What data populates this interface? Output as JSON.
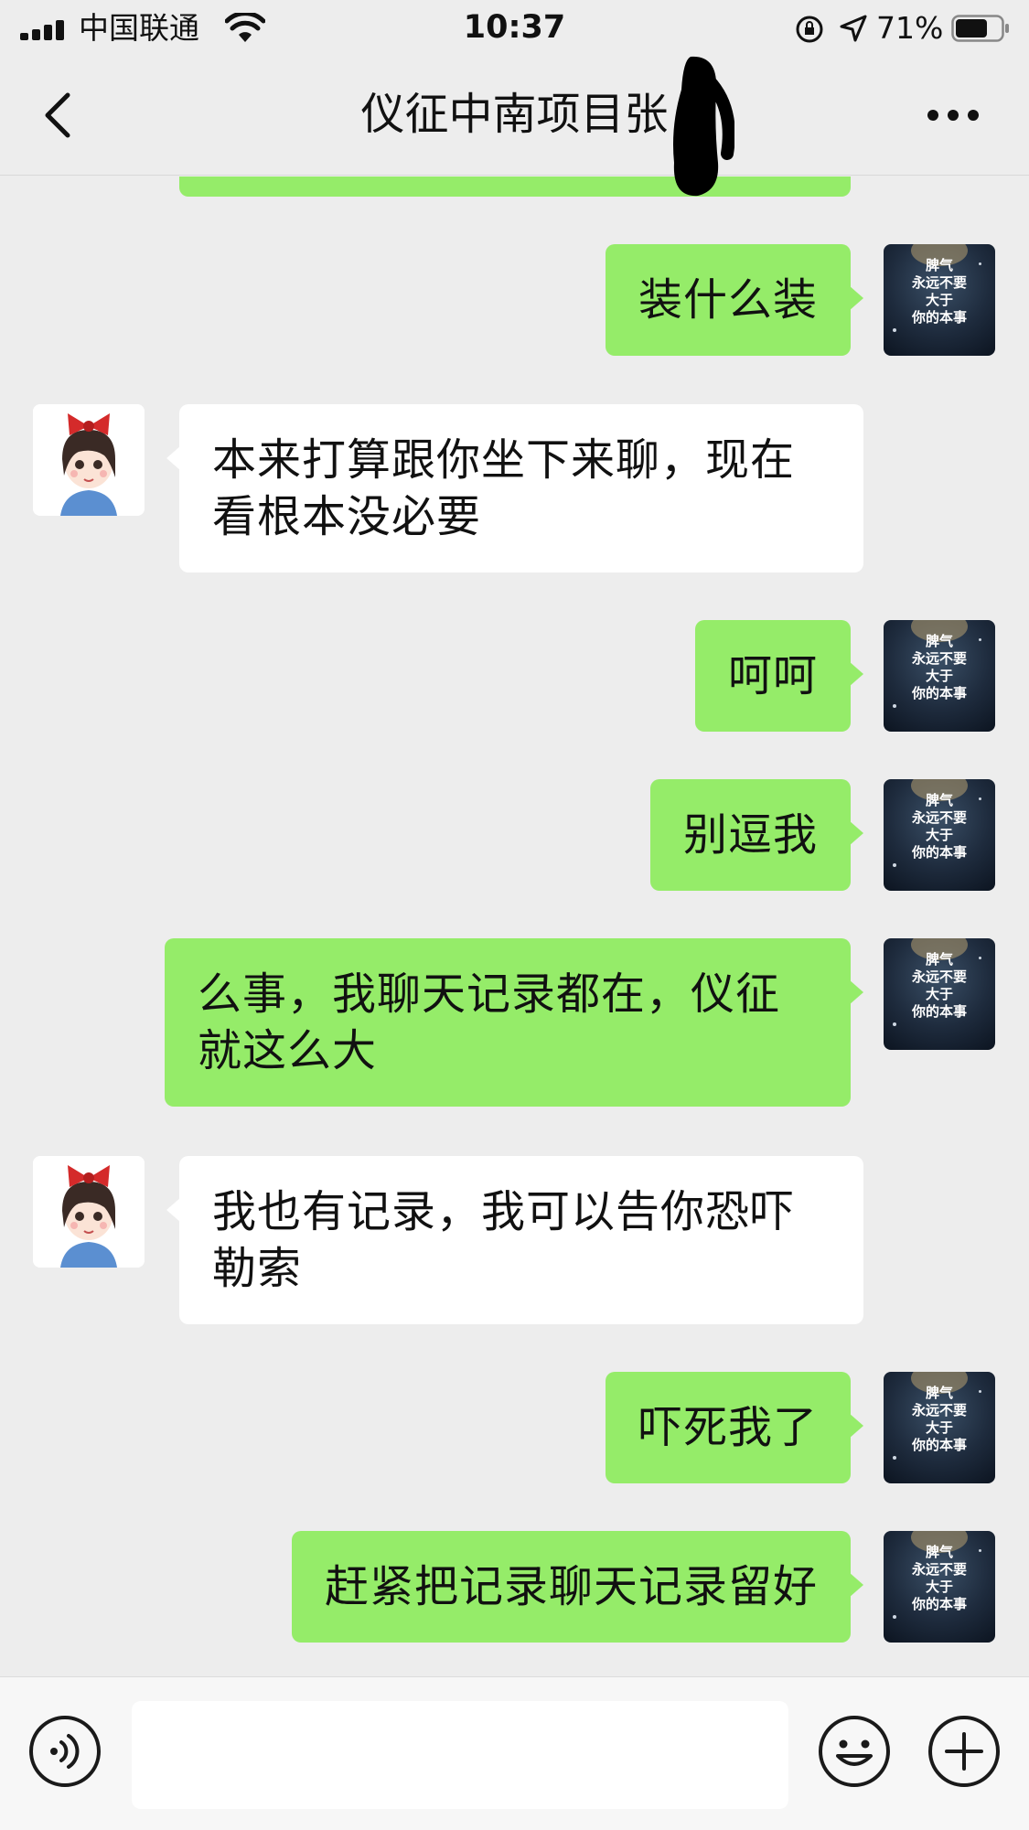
{
  "status_bar": {
    "carrier": "中国联通",
    "time": "10:37",
    "battery_percent": "71%",
    "battery_level": 0.71,
    "icons": [
      "signal-icon",
      "wifi-icon",
      "rotation-lock-icon",
      "location-arrow-icon",
      "battery-icon"
    ]
  },
  "nav": {
    "title": "仪征中南项目张",
    "back_icon": "chevron-left-icon",
    "more_icon": "ellipsis-icon"
  },
  "self_avatar_text": [
    "脾气",
    "永远不要",
    "大于",
    "你的本事"
  ],
  "messages": [
    {
      "sender": "self",
      "text": "装什么装"
    },
    {
      "sender": "other",
      "text": "本来打算跟你坐下来聊，现在看根本没必要"
    },
    {
      "sender": "self",
      "text": "呵呵"
    },
    {
      "sender": "self",
      "text": "别逗我"
    },
    {
      "sender": "self",
      "text": "么事，我聊天记录都在，仪征就这么大"
    },
    {
      "sender": "other",
      "text": "我也有记录，我可以告你恐吓勒索"
    },
    {
      "sender": "self",
      "text": "吓死我了"
    },
    {
      "sender": "self",
      "text": "赶紧把记录聊天记录留好"
    }
  ],
  "input_bar": {
    "message_value": "",
    "icons": [
      "voice-icon",
      "emoji-icon",
      "plus-icon"
    ]
  },
  "colors": {
    "background": "#ededed",
    "self_bubble": "#95ec69",
    "other_bubble": "#ffffff",
    "input_bar": "#f7f7f7"
  }
}
